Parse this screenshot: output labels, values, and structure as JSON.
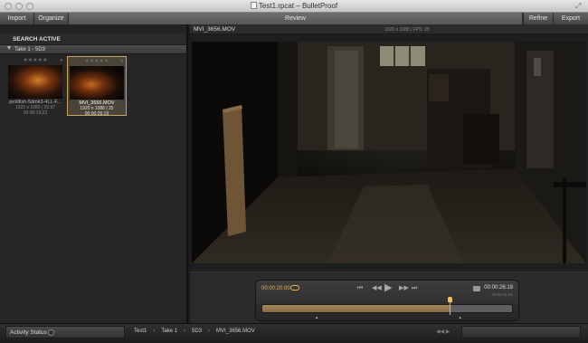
{
  "window": {
    "title": "Test1.rpcat – BulletProof"
  },
  "toolbar": {
    "import_label": "Import",
    "organize_label": "Organize",
    "review_label": "Review",
    "refine_label": "Refine",
    "export_label": "Export"
  },
  "sidebar": {
    "search_label": "SEARCH ACTIVE",
    "group_label": "Take 1 - 5D3",
    "thumbnails": [
      {
        "stars": "★★★★★",
        "name": "prolifish-5dmk3-4LL-F...",
        "meta1": "1920 x 1080 | 29.97",
        "meta2": "00:00:19;23",
        "selected": false
      },
      {
        "stars": "★★★★★",
        "name": "MVI_3656.MOV",
        "meta1": "1920 x 1088 | 25",
        "meta2": "00:00:26:19",
        "selected": true
      }
    ]
  },
  "viewer": {
    "clip_name": "MVI_3656.MOV",
    "clip_meta": "1920 x 1088 | FPS: 25"
  },
  "transport": {
    "current_time": "00:00:20:00",
    "total_time": "00:00:26:19",
    "total_time_secondary": "00:00:11:06",
    "progress": 0.75,
    "marker_left": 0.22,
    "marker_right": 0.79
  },
  "statusbar": {
    "activity_label": "Activity Status",
    "breadcrumbs": [
      "Test1",
      "Take 1",
      "5D3",
      "MVI_3656.MOV"
    ]
  },
  "colors": {
    "accent": "#e7b449",
    "timeline_fill": "#a58658"
  },
  "icons": {
    "loop": "loop-icon",
    "go_start": "skip-to-start-icon",
    "rewind": "step-back-icon",
    "play": "play-icon",
    "forward": "step-forward-icon",
    "go_end": "skip-to-end-icon",
    "snapshot": "camera-icon"
  }
}
